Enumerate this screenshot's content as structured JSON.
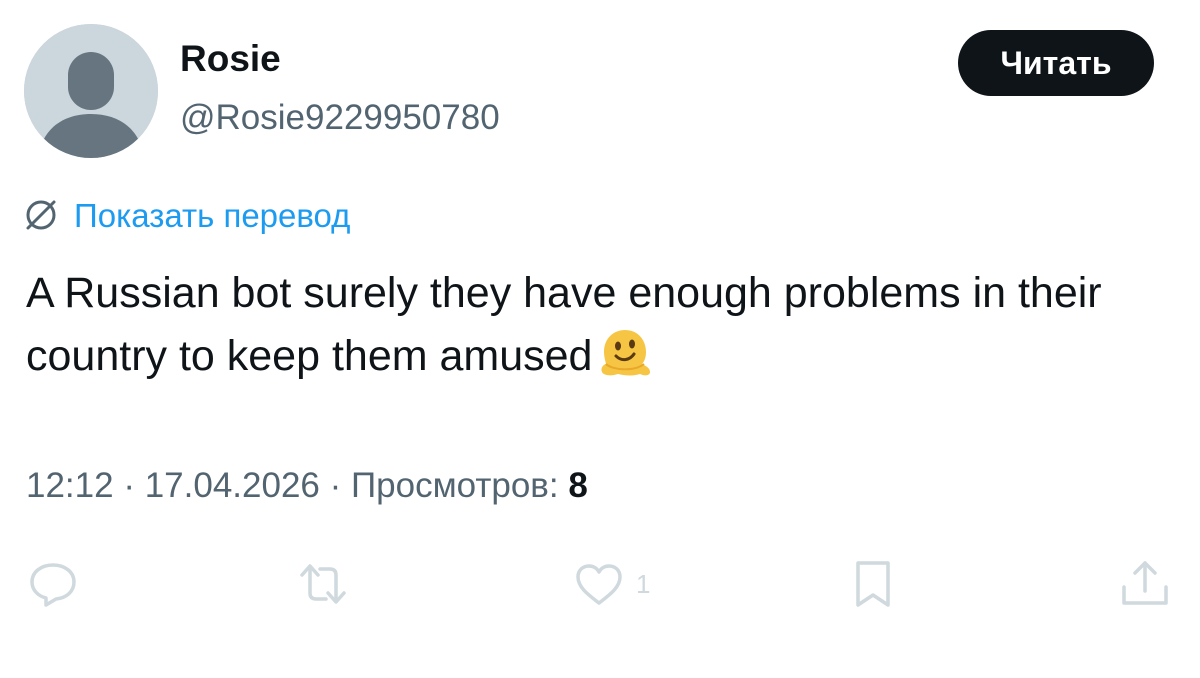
{
  "author": {
    "name": "Rosie",
    "handle": "@Rosie9229950780",
    "avatar_icon": "default-avatar-icon"
  },
  "follow_button": {
    "label": "Читать"
  },
  "translate": {
    "label": "Показать перевод",
    "icon": "translate-globe-icon"
  },
  "tweet": {
    "text": "A Russian bot surely they have enough problems in their country to keep them amused",
    "emoji": "melting-face"
  },
  "meta": {
    "time": "12:12",
    "separator": " · ",
    "date": "17.04.2026",
    "views_label": "Просмотров:",
    "views_count": "8"
  },
  "actions": {
    "reply_icon": "reply-icon",
    "retweet_icon": "retweet-icon",
    "like_icon": "like-icon",
    "like_count": "1",
    "bookmark_icon": "bookmark-icon",
    "share_icon": "share-icon"
  },
  "colors": {
    "text": "#0f1419",
    "secondary": "#536471",
    "link": "#1d9bf0",
    "action_icons": "#cfd9de",
    "button_bg": "#0f1419"
  }
}
